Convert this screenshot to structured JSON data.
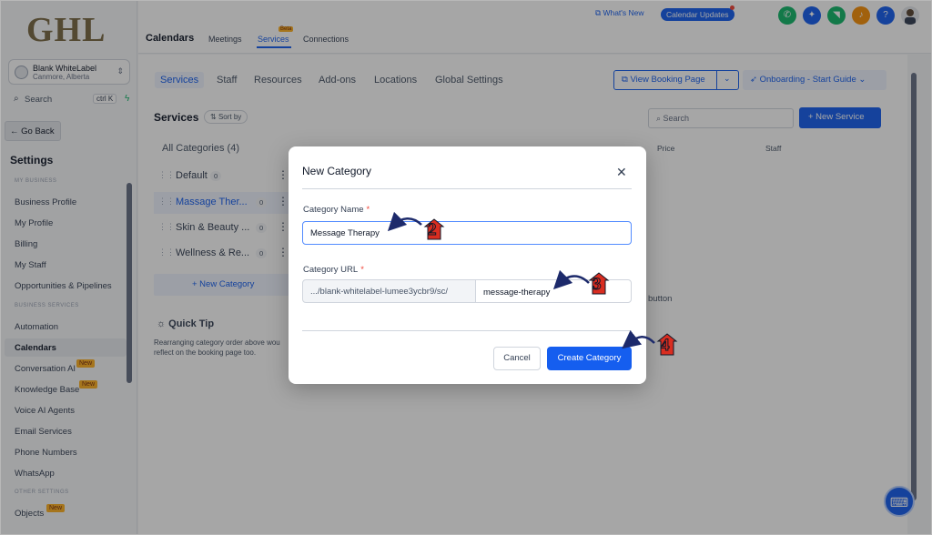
{
  "sidebar": {
    "logo": "GHL",
    "account": {
      "name": "Blank WhiteLabel",
      "location": "Canmore, Alberta"
    },
    "search": {
      "label": "Search",
      "shortcut": "ctrl K"
    },
    "go_back": "Go Back",
    "title": "Settings",
    "sections": {
      "my_business": "MY BUSINESS",
      "business_services": "BUSINESS SERVICES",
      "other_settings": "OTHER SETTINGS"
    },
    "items": [
      {
        "label": "Business Profile"
      },
      {
        "label": "My Profile"
      },
      {
        "label": "Billing"
      },
      {
        "label": "My Staff"
      },
      {
        "label": "Opportunities & Pipelines"
      },
      {
        "label": "Automation"
      },
      {
        "label": "Calendars"
      },
      {
        "label": "Conversation AI",
        "badge": "New"
      },
      {
        "label": "Knowledge Base",
        "badge": "New"
      },
      {
        "label": "Voice AI Agents"
      },
      {
        "label": "Email Services"
      },
      {
        "label": "Phone Numbers"
      },
      {
        "label": "WhatsApp"
      },
      {
        "label": "Objects",
        "badge": "New"
      }
    ]
  },
  "header": {
    "title": "Calendars",
    "tabs": [
      "Meetings",
      "Services",
      "Connections"
    ],
    "services_badge": "Beta",
    "whats_new": "What's New",
    "calendar_updates": "Calendar Updates"
  },
  "subnav": {
    "tabs": [
      "Services",
      "Staff",
      "Resources",
      "Add-ons",
      "Locations",
      "Global Settings"
    ],
    "view_booking_page": "View Booking Page",
    "onboarding": "Onboarding - Start Guide"
  },
  "services": {
    "title": "Services",
    "sort_by": "Sort by",
    "search_placeholder": "Search",
    "new_service": "+ New Service",
    "all_categories": "All Categories (4)",
    "categories": [
      {
        "name": "Default",
        "count": "0"
      },
      {
        "name": "Massage Ther...",
        "count": "0"
      },
      {
        "name": "Skin & Beauty ...",
        "count": "0"
      },
      {
        "name": "Wellness & Re...",
        "count": "0"
      }
    ],
    "new_category": "+ New Category",
    "quick_tip_title": "Quick Tip",
    "quick_tip_text": "Rearranging category order above wou reflect on the booking page too.",
    "table_headers": [
      "Price",
      "Staff"
    ],
    "empty_text": "button"
  },
  "modal": {
    "title": "New Category",
    "name_label": "Category Name",
    "name_value": "Message Therapy",
    "url_label": "Category URL",
    "url_prefix": ".../blank-whitelabel-lumee3ycbr9/sc/",
    "url_slug": "message-therapy",
    "required_mark": "*",
    "cancel": "Cancel",
    "create": "Create Category"
  },
  "annotations": [
    "2",
    "3",
    "4"
  ],
  "colors": {
    "primary": "#155eef",
    "annotation": "#d92d20",
    "badge": "#fdb022"
  }
}
